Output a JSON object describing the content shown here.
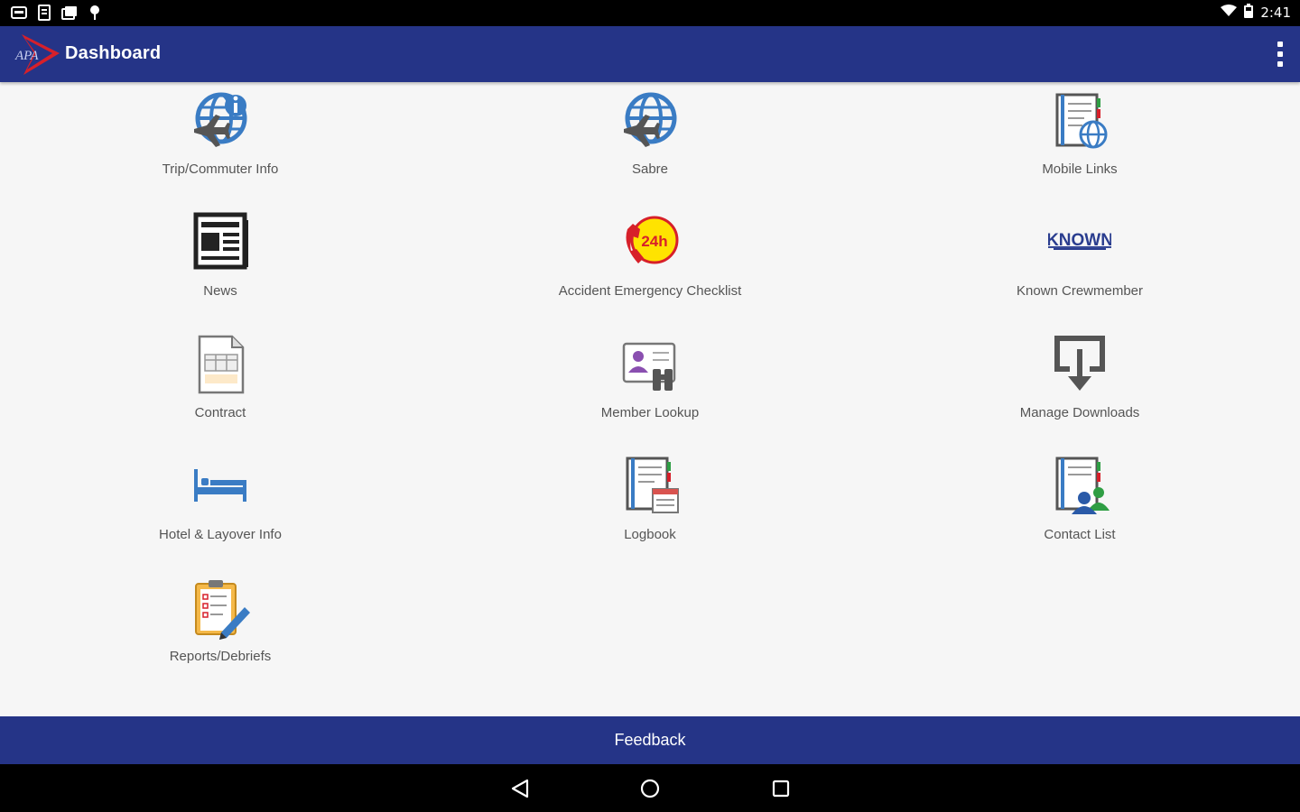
{
  "status_bar": {
    "time": "2:41",
    "left_icons": [
      "notification-icon",
      "sd-card-icon",
      "photos-icon",
      "pin-icon"
    ],
    "right_icons": [
      "wifi-icon",
      "battery-icon"
    ]
  },
  "app_bar": {
    "logo_text": "APA",
    "title": "Dashboard",
    "menu_icon": "more-vert-icon"
  },
  "tiles": [
    {
      "label": "Trip/Commuter Info",
      "icon": "globe-plane-info-icon"
    },
    {
      "label": "Sabre",
      "icon": "globe-plane-icon"
    },
    {
      "label": "Mobile Links",
      "icon": "notebook-globe-icon"
    },
    {
      "label": "News",
      "icon": "newspaper-icon"
    },
    {
      "label": "Accident Emergency Checklist",
      "icon": "emergency-24h-icon",
      "icon_text": "24h"
    },
    {
      "label": "Known Crewmember",
      "icon": "known-logo-icon",
      "icon_text": "KNOWN"
    },
    {
      "label": "Contract",
      "icon": "document-icon"
    },
    {
      "label": "Member Lookup",
      "icon": "id-card-binoculars-icon"
    },
    {
      "label": "Manage Downloads",
      "icon": "download-icon"
    },
    {
      "label": "Hotel & Layover Info",
      "icon": "bed-icon"
    },
    {
      "label": "Logbook",
      "icon": "logbook-icon"
    },
    {
      "label": "Contact List",
      "icon": "contacts-icon"
    },
    {
      "label": "Reports/Debriefs",
      "icon": "clipboard-pencil-icon"
    }
  ],
  "footer": {
    "feedback_label": "Feedback"
  },
  "nav_bar": {
    "back_icon": "back-icon",
    "home_icon": "home-icon",
    "recents_icon": "recents-icon"
  },
  "colors": {
    "brand_blue": "#253487",
    "accent_red": "#d7202a",
    "icon_blue": "#3a7cc4",
    "label_gray": "#555555",
    "background": "#f6f6f6"
  }
}
